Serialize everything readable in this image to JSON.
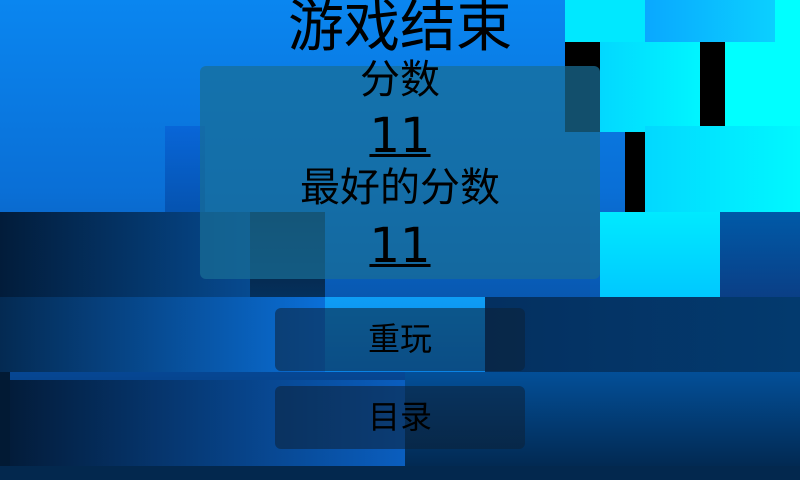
{
  "game_over": {
    "title": "游戏结束",
    "score_label": "分数",
    "score_value": "11",
    "best_label": "最好的分数",
    "best_value": "11"
  },
  "buttons": {
    "replay": "重玩",
    "menu": "目录"
  },
  "colors": {
    "sky_top": "#0a86f0",
    "cyan_block": "#00f0ff",
    "panel": "#1d8ea0",
    "button_bg": "#0c2037"
  }
}
